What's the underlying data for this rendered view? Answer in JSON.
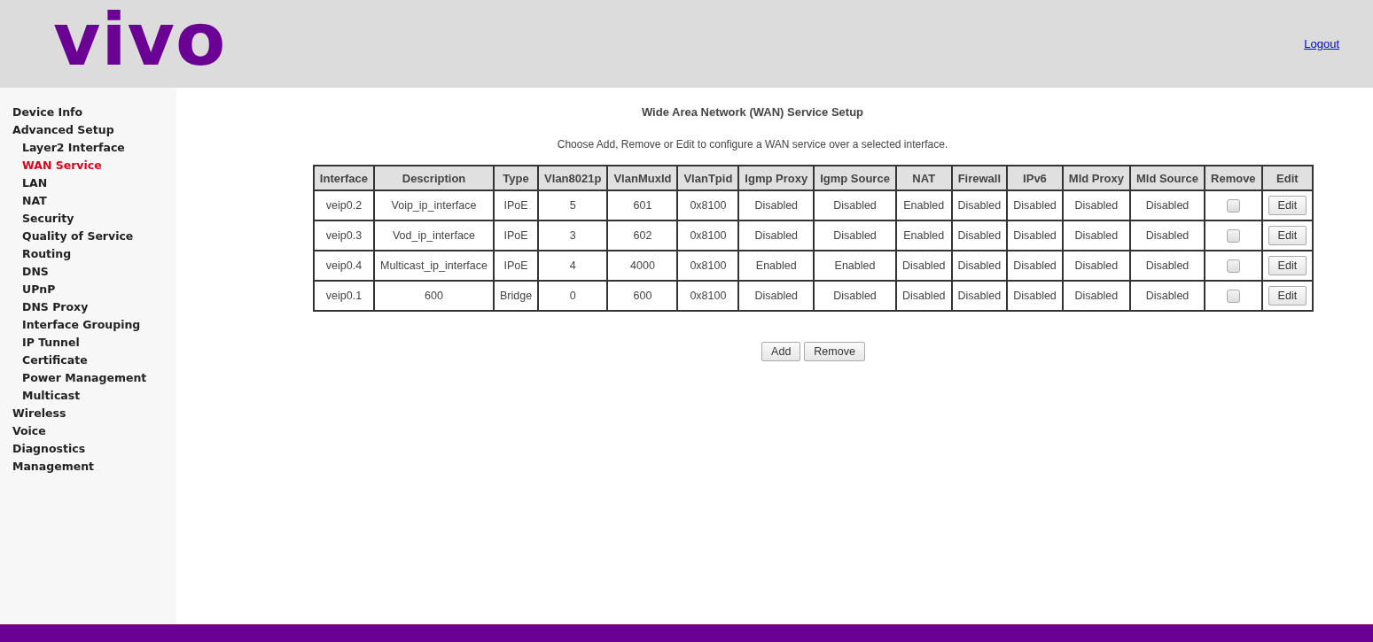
{
  "header": {
    "logo": "vivo",
    "logout": "Logout"
  },
  "sidebar": {
    "items": [
      {
        "label": "Device Info",
        "selected": false
      },
      {
        "label": "Advanced Setup",
        "selected": false,
        "children": [
          {
            "label": "Layer2 Interface",
            "selected": false
          },
          {
            "label": "WAN Service",
            "selected": true
          },
          {
            "label": "LAN",
            "selected": false
          },
          {
            "label": "NAT",
            "selected": false
          },
          {
            "label": "Security",
            "selected": false
          },
          {
            "label": "Quality of Service",
            "selected": false
          },
          {
            "label": "Routing",
            "selected": false
          },
          {
            "label": "DNS",
            "selected": false
          },
          {
            "label": "UPnP",
            "selected": false
          },
          {
            "label": "DNS Proxy",
            "selected": false
          },
          {
            "label": "Interface Grouping",
            "selected": false
          },
          {
            "label": "IP Tunnel",
            "selected": false
          },
          {
            "label": "Certificate",
            "selected": false
          },
          {
            "label": "Power Management",
            "selected": false
          },
          {
            "label": "Multicast",
            "selected": false
          }
        ]
      },
      {
        "label": "Wireless",
        "selected": false
      },
      {
        "label": "Voice",
        "selected": false
      },
      {
        "label": "Diagnostics",
        "selected": false
      },
      {
        "label": "Management",
        "selected": false
      }
    ]
  },
  "main": {
    "title": "Wide Area Network (WAN) Service Setup",
    "instructions": "Choose Add, Remove or Edit to configure a WAN service over a selected interface.",
    "table": {
      "columns": [
        "Interface",
        "Description",
        "Type",
        "Vlan8021p",
        "VlanMuxId",
        "VlanTpid",
        "Igmp Proxy",
        "Igmp Source",
        "NAT",
        "Firewall",
        "IPv6",
        "Mld Proxy",
        "Mld Source",
        "Remove",
        "Edit"
      ],
      "rows": [
        {
          "cells": [
            "veip0.2",
            "Voip_ip_interface",
            "IPoE",
            "5",
            "601",
            "0x8100",
            "Disabled",
            "Disabled",
            "Enabled",
            "Disabled",
            "Disabled",
            "Disabled",
            "Disabled"
          ],
          "remove_checked": false,
          "edit": "Edit"
        },
        {
          "cells": [
            "veip0.3",
            "Vod_ip_interface",
            "IPoE",
            "3",
            "602",
            "0x8100",
            "Disabled",
            "Disabled",
            "Enabled",
            "Disabled",
            "Disabled",
            "Disabled",
            "Disabled"
          ],
          "remove_checked": false,
          "edit": "Edit"
        },
        {
          "cells": [
            "veip0.4",
            "Multicast_ip_interface",
            "IPoE",
            "4",
            "4000",
            "0x8100",
            "Enabled",
            "Enabled",
            "Disabled",
            "Disabled",
            "Disabled",
            "Disabled",
            "Disabled"
          ],
          "remove_checked": false,
          "edit": "Edit"
        },
        {
          "cells": [
            "veip0.1",
            "600",
            "Bridge",
            "0",
            "600",
            "0x8100",
            "Disabled",
            "Disabled",
            "Disabled",
            "Disabled",
            "Disabled",
            "Disabled",
            "Disabled"
          ],
          "remove_checked": false,
          "edit": "Edit"
        }
      ]
    },
    "buttons": [
      "Add",
      "Remove"
    ]
  }
}
